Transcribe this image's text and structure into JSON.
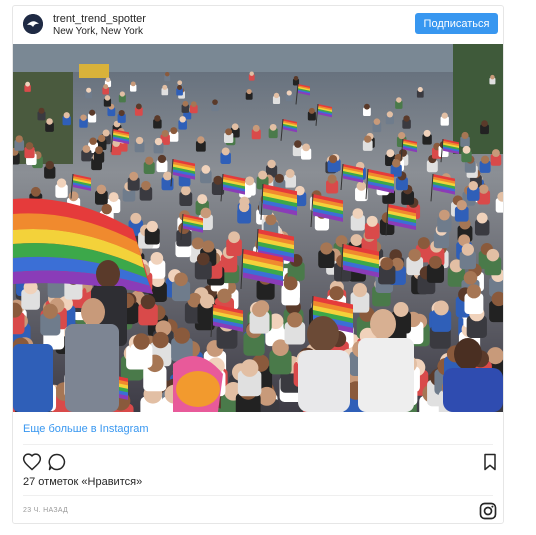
{
  "header": {
    "username": "trent_trend_spotter",
    "location": "New York, New York",
    "follow_label": "Подписаться"
  },
  "post": {
    "image_icon": "parade-photo",
    "more_link": "Еще больше в Instagram",
    "likes_text": "27 отметок «Нравится»",
    "time_text": "23 Ч. НАЗАД"
  },
  "icons": {
    "like": "heart-icon",
    "comment": "comment-icon",
    "save": "bookmark-icon",
    "instagram": "instagram-icon"
  },
  "colors": {
    "accent": "#3897f0",
    "text": "#262626",
    "muted": "#999999",
    "border": "#e6e6e6"
  }
}
